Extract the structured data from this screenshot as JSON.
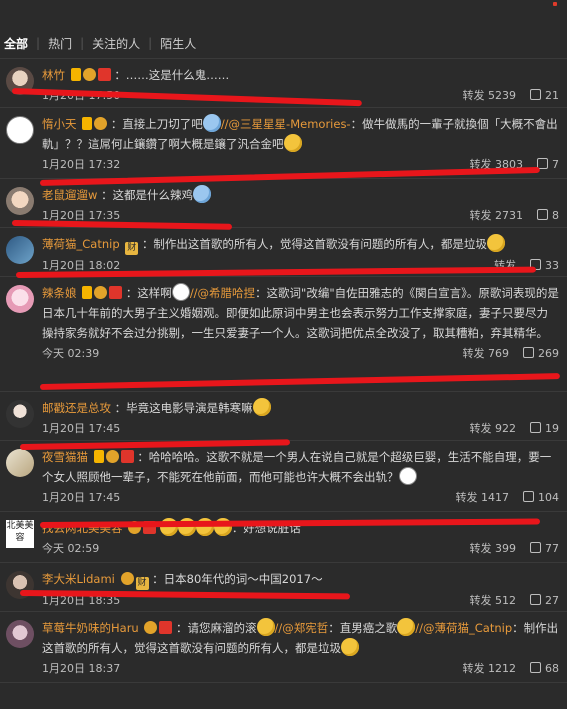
{
  "tabs": [
    "全部",
    "热门",
    "关注的人",
    "陌生人"
  ],
  "comments": [
    {
      "name": "林竹",
      "badges": [
        "v",
        "medal",
        "red"
      ],
      "text": "：……这是什么鬼……",
      "time": "1月20日 17:50",
      "repost": "转发 5239",
      "likes": "21"
    },
    {
      "name": "惰小天",
      "badges": [
        "v",
        "medal"
      ],
      "text_a": "：直接上刀切了吧",
      "mention": "//@三星星星-Memories-",
      "text_b": "：做牛做馬的一輩子就換個「大概不會出軌」？？這屌何止鑲鑽了啊大概是鑲了汎合金吧",
      "time": "1月20日 17:32",
      "repost": "转发 3803",
      "likes": "7"
    },
    {
      "name": "老鼠遛遛w",
      "badges": [],
      "text": "：这都是什么辣鸡",
      "time": "1月20日 17:35",
      "repost": "转发 2731",
      "likes": "8"
    },
    {
      "name": "薄荷猫_Catnip",
      "badges": [
        "fin"
      ],
      "text": "：制作出这首歌的所有人，觉得这首歌没有问题的所有人，都是垃圾",
      "time": "1月20日 18:02",
      "repost": "转发",
      "likes": "33"
    },
    {
      "name": "辣条娘",
      "badges": [
        "v",
        "medal",
        "red"
      ],
      "text_a": "：这样啊",
      "mention": "//@希腊哈捏",
      "text_b": "：这歌词\"改编\"自佐田雅志的《関白宣言》。原歌词表现的是日本几十年前的大男子主义婚姻观。即便如此原词中男主也会表示努力工作支撑家庭，妻子只要尽力操持家务就好不会过分挑剔，一生只爱妻子一个人。这歌词把优点全改没了，取其糟粕，弃其精华。",
      "time": "今天 02:39",
      "repost": "转发 769",
      "likes": "269"
    },
    {
      "name": "邮戳还是总攻",
      "badges": [],
      "text": "：毕竟这电影导演是韩寒嘛",
      "time": "1月20日 17:45",
      "repost": "转发 922",
      "likes": "19"
    },
    {
      "name": "夜雪猫猫",
      "badges": [
        "v",
        "medal",
        "red"
      ],
      "text": "：哈哈哈哈。这歌不就是一个男人在说自己就是个超级巨婴，生活不能自理，要一个女人照顾他一辈子，不能死在他前面，而他可能也许大概不会出轨？",
      "time": "1月20日 17:45",
      "repost": "转发 1417",
      "likes": "104"
    },
    {
      "name": "找丢网北美美容",
      "badges": [
        "medal",
        "red"
      ],
      "text": "：好想说脏话",
      "time": "今天 02:59",
      "repost": "转发 399",
      "likes": "77"
    },
    {
      "name": "李大米Lidami",
      "badges": [
        "medal",
        "fin"
      ],
      "text": "：日本80年代的词～中国2017～",
      "time": "1月20日 18:35",
      "repost": "转发 512",
      "likes": "27"
    },
    {
      "name": "草莓牛奶味的Haru",
      "badges": [
        "medal",
        "red"
      ],
      "text_a": "：请您麻溜的滚",
      "mention": "//@郑宪哲",
      "text_b": "：直男癌之歌",
      "mention2": "//@薄荷猫_Catnip",
      "text_c": "：制作出这首歌的所有人，觉得这首歌没有问题的所有人，都是垃圾",
      "time": "1月20日 18:37",
      "repost": "转发 1212",
      "likes": "68"
    }
  ],
  "avatar_text_8": "北美美容",
  "colors": {
    "background": "#2b2b2b",
    "name": "#e79a3b",
    "scribble": "#e8161b"
  }
}
